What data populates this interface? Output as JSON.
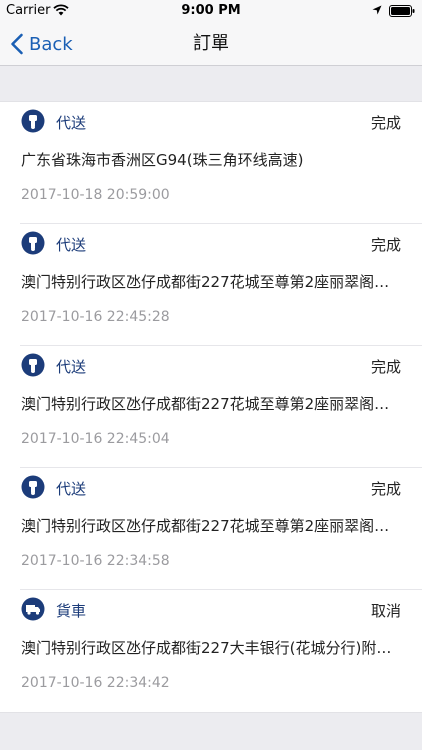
{
  "status_bar": {
    "carrier": "Carrier",
    "time": "9:00 PM"
  },
  "nav": {
    "back_label": "Back",
    "title": "訂單"
  },
  "orders": [
    {
      "service": "代送",
      "icon": "scooter-icon",
      "status": "完成",
      "address": "广东省珠海市香洲区G94(珠三角环线高速)",
      "datetime": "2017-10-18 20:59:00"
    },
    {
      "service": "代送",
      "icon": "scooter-icon",
      "status": "完成",
      "address": "澳门特别行政区氹仔成都街227花城至尊第2座丽翠阁…",
      "datetime": "2017-10-16 22:45:28"
    },
    {
      "service": "代送",
      "icon": "scooter-icon",
      "status": "完成",
      "address": "澳门特别行政区氹仔成都街227花城至尊第2座丽翠阁…",
      "datetime": "2017-10-16 22:45:04"
    },
    {
      "service": "代送",
      "icon": "scooter-icon",
      "status": "完成",
      "address": "澳门特别行政区氹仔成都街227花城至尊第2座丽翠阁…",
      "datetime": "2017-10-16 22:34:58"
    },
    {
      "service": "貨車",
      "icon": "truck-icon",
      "status": "取消",
      "address": "澳门特别行政区氹仔成都街227大丰银行(花城分行)附…",
      "datetime": "2017-10-16 22:34:42"
    }
  ],
  "colors": {
    "accent": "#1a5fb4",
    "icon_bg": "#1c3c7a",
    "status_text": "#222222",
    "date_text": "#9b9b9f"
  }
}
